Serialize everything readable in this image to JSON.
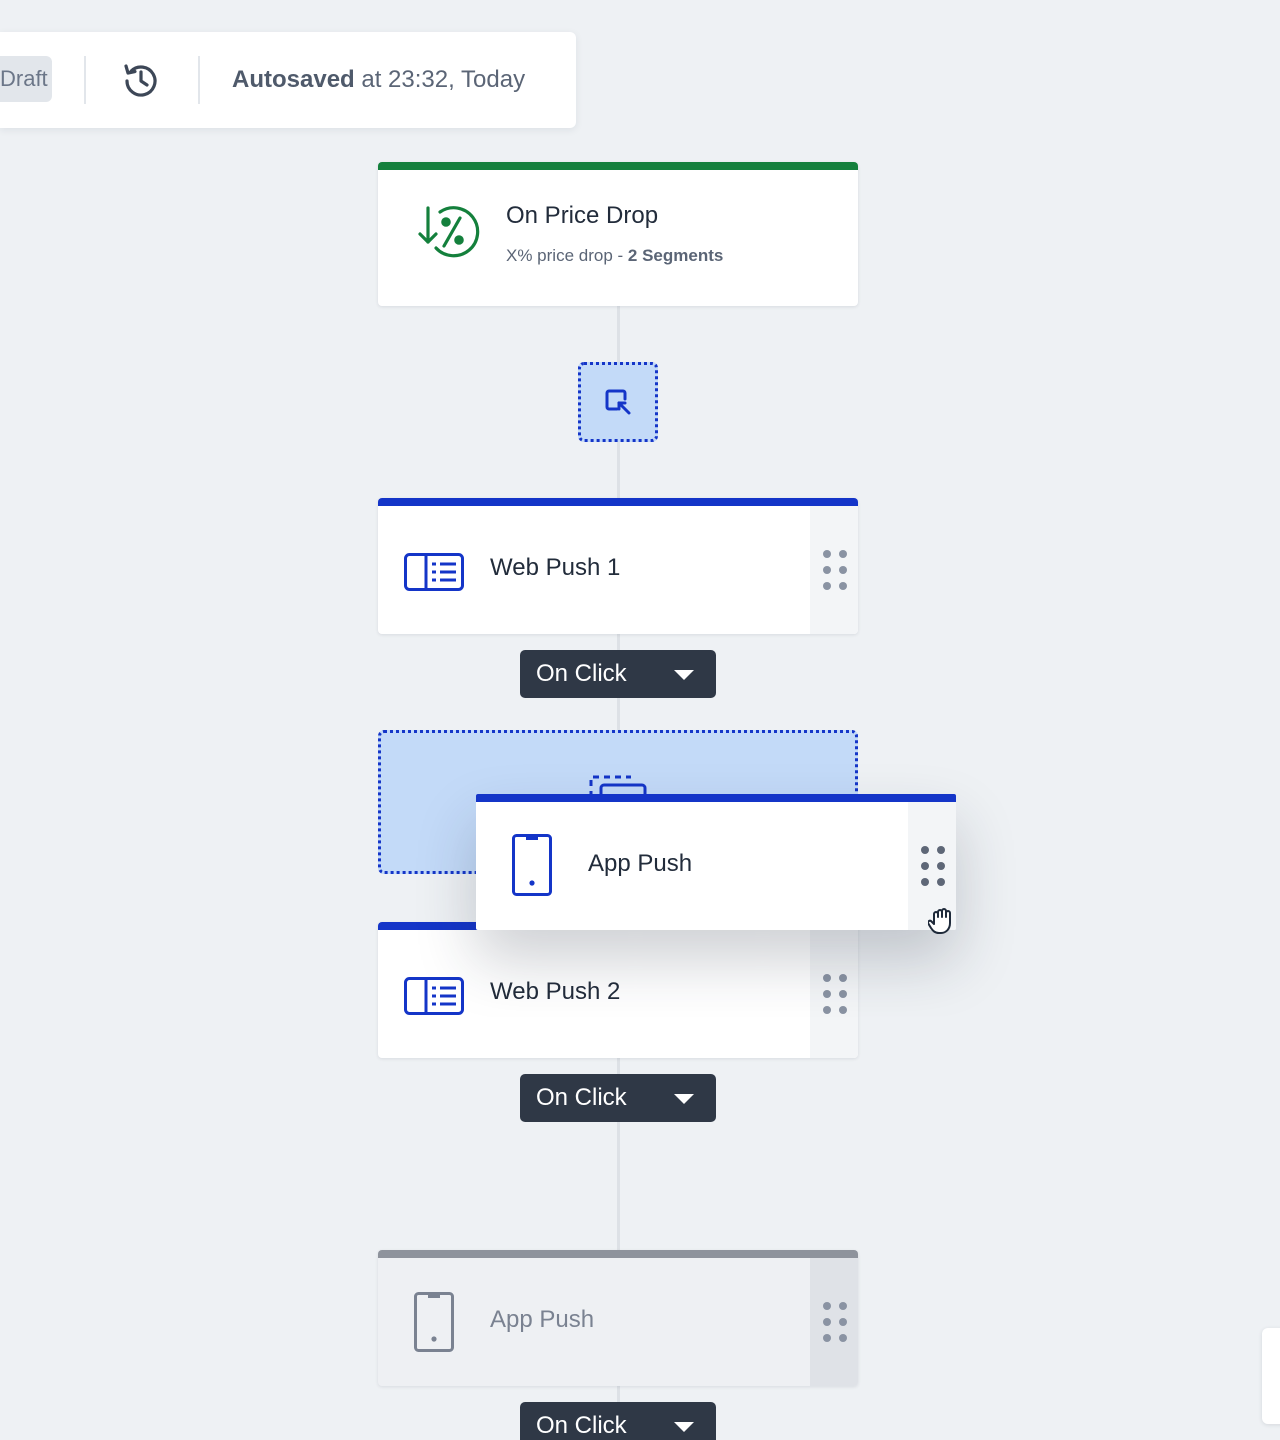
{
  "header": {
    "draft_label": "Draft",
    "autosave_bold": "Autosaved",
    "autosave_rest": "at 23:32, Today"
  },
  "trigger": {
    "title": "On Price Drop",
    "subtitle_prefix": "X% price drop - ",
    "subtitle_bold": "2 Segments",
    "color": "#14803c"
  },
  "nodes": [
    {
      "title": "Web Push 1",
      "icon": "web-push-icon"
    },
    {
      "title": "App Push",
      "icon": "app-push-icon",
      "state": "dragging"
    },
    {
      "title": "Web Push 2",
      "icon": "web-push-icon"
    },
    {
      "title": "App Push",
      "icon": "app-push-icon",
      "state": "disabled"
    }
  ],
  "connectors": [
    {
      "label": "On Click"
    },
    {
      "label": "On Click"
    },
    {
      "label": "On Click"
    }
  ],
  "colors": {
    "accent": "#1435c8",
    "drop_zone": "#c3daf8",
    "connector_bg": "#2f3846",
    "canvas_bg": "#eef1f4"
  }
}
